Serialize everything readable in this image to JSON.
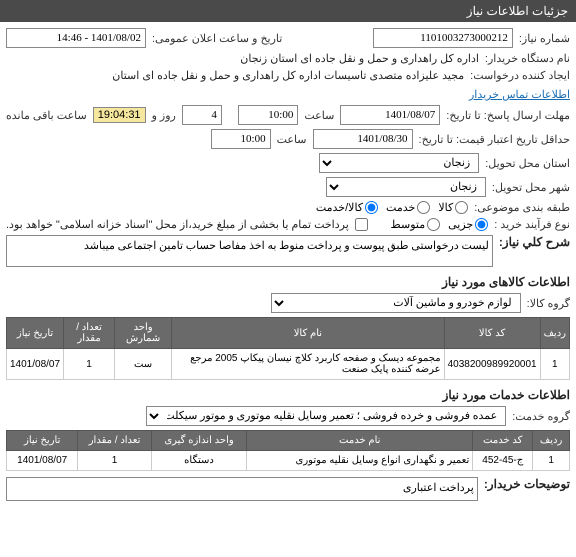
{
  "header": "جزئیات اطلاعات نیاز",
  "fields": {
    "need_number_label": "شماره نیاز:",
    "need_number": "1101003273000212",
    "announce_label": "تاریخ و ساعت اعلان عمومی:",
    "announce_value": "1401/08/02 - 14:46",
    "buyer_label": "نام دستگاه خریدار:",
    "buyer_value": "اداره کل راهداری و حمل و نقل جاده ای استان زنجان",
    "creator_label": "ایجاد کننده درخواست:",
    "creator_value": "مجید علیزاده متصدی تاسیسات اداره کل راهداری و حمل و نقل جاده ای استان",
    "contact_link": "اطلاعات تماس خریدار",
    "deadline_send_label": "مهلت ارسال پاسخ: تا تاریخ:",
    "deadline_send_date": "1401/08/07",
    "hour_label": "ساعت",
    "deadline_send_time": "10:00",
    "days_value": "4",
    "days_label": "روز و",
    "countdown": "19:04:31",
    "remaining_label": "ساعت باقی مانده",
    "credit_expire_label": "حداقل تاریخ اعتبار قیمت: تا تاریخ:",
    "credit_expire_date": "1401/08/30",
    "credit_expire_time": "10:00",
    "province_label": "استان محل تحویل:",
    "province_value": "زنجان",
    "city_label": "شهر محل تحویل:",
    "city_value": "زنجان",
    "subject_class_label": "طبقه بندی موضوعی:",
    "subject_options": {
      "goods": "کالا",
      "service": "خدمت",
      "goods_service": "کالا/خدمت"
    },
    "buy_process_label": "نوع فرآیند خرید :",
    "buy_process_options": {
      "minor": "جزیی",
      "medium": "متوسط"
    },
    "payment_note": "پرداخت تمام یا بخشی از مبلغ خرید،از محل \"اسناد خزانه اسلامی\" خواهد بود.",
    "desc_label": "شرح کلي نیاز:",
    "desc_value": "لیست درخواستی طبق پیوست و پرداخت منوط به اخذ مفاصا حساب تامین اجتماعی میباشد",
    "goods_section": "اطلاعات کالاهای مورد نیاز",
    "goods_group_label": "گروه کالا:",
    "goods_group_value": "لوازم خودرو و ماشین آلات",
    "services_section": "اطلاعات خدمات مورد نیاز",
    "services_group_label": "گروه خدمت:",
    "services_group_value": "عمده فروشی و خرده فروشی ؛  تعمیر وسایل نقلیه موتوری و موتور سیکلت",
    "notes_label": "توضیحات خریدار:",
    "notes_value": "پرداخت اعتباری"
  },
  "goods_table": {
    "headers": [
      "ردیف",
      "کد کالا",
      "نام کالا",
      "واحد شمارش",
      "تعداد / مقدار",
      "تاریخ نیاز"
    ],
    "row": {
      "idx": "1",
      "code": "4038200989920001",
      "name": "مجموعه دیسک و صفحه کاربرد کلاچ نیسان پیکاپ 2005 مرجع عرضه کننده پایک صنعت",
      "unit": "ست",
      "qty": "1",
      "date": "1401/08/07"
    }
  },
  "services_table": {
    "headers": [
      "ردیف",
      "کد خدمت",
      "نام خدمت",
      "واحد اندازه گیری",
      "تعداد / مقدار",
      "تاریخ نیاز"
    ],
    "row": {
      "idx": "1",
      "code": "ج-45-452",
      "name": "تعمیر و نگهداری انواع وسایل نقلیه موتوری",
      "unit": "دستگاه",
      "qty": "1",
      "date": "1401/08/07"
    }
  }
}
